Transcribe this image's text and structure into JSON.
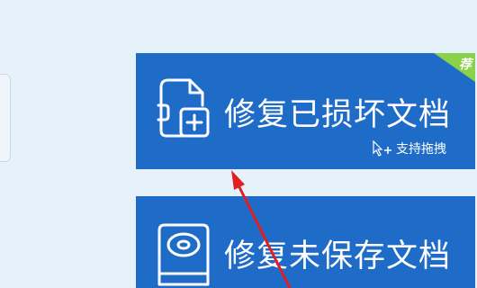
{
  "tiles": [
    {
      "title": "修复已损坏文档",
      "hint": "支持拖拽",
      "badge": "荐",
      "icon": "document-repair-icon"
    },
    {
      "title": "修复未保存文档",
      "icon": "hard-drive-icon"
    }
  ],
  "colors": {
    "background": "#e6f2fa",
    "tile": "#1e6cc8",
    "badge": "#8bd14a",
    "arrow": "#e02020"
  }
}
